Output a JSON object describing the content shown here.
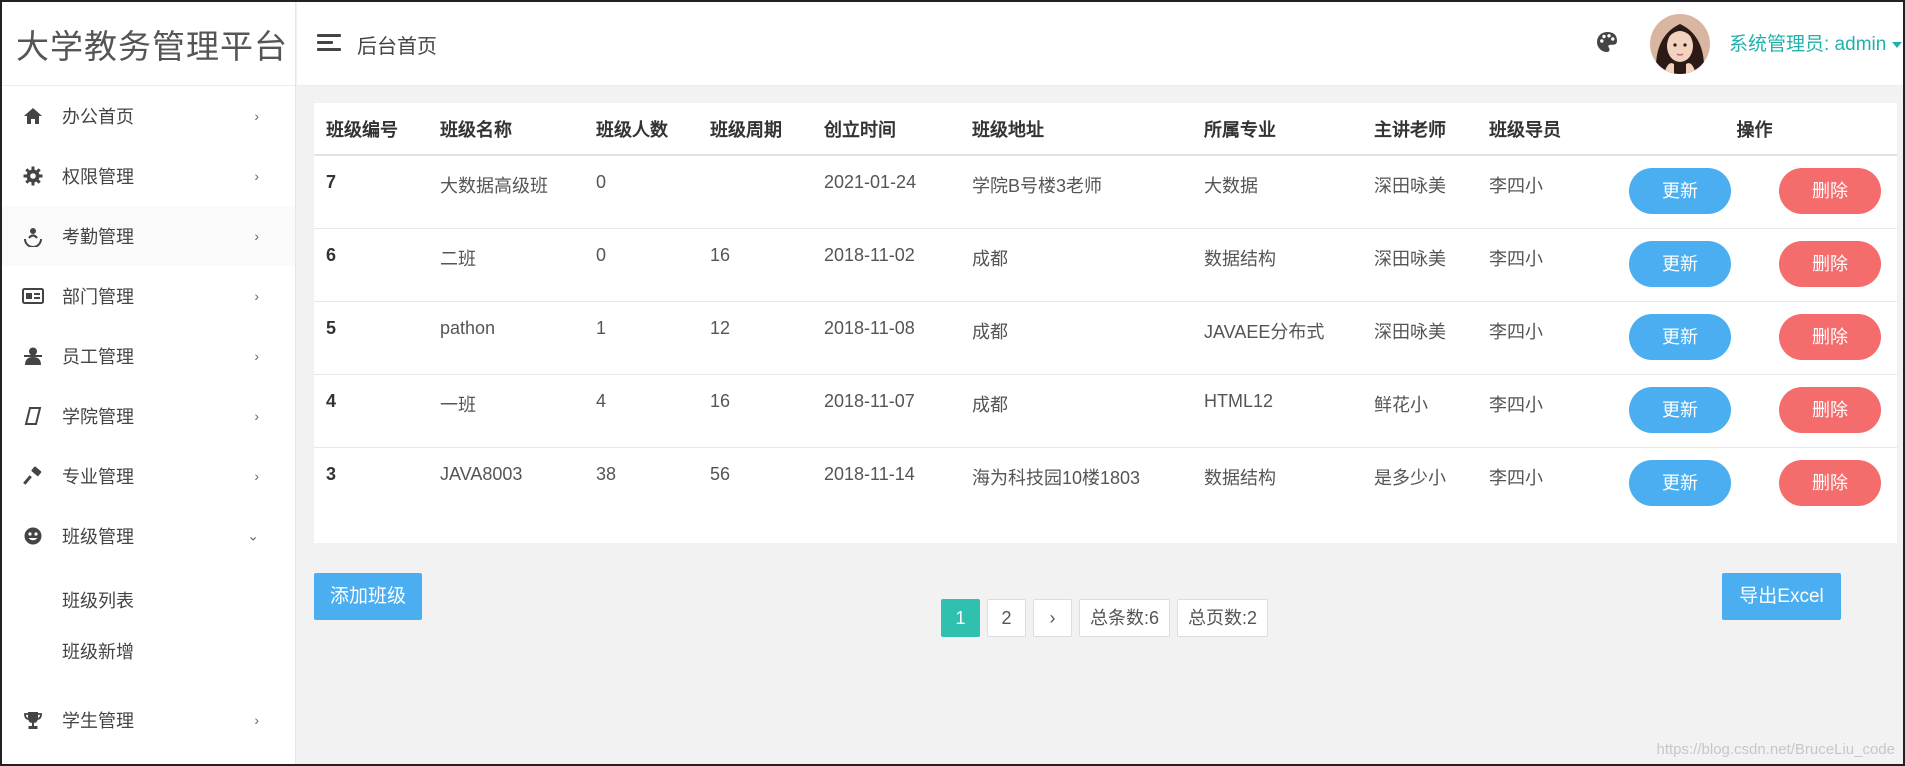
{
  "app": {
    "title": "大学教务管理平台"
  },
  "header": {
    "breadcrumb": "后台首页",
    "user_label": "系统管理员: admin"
  },
  "sidebar": {
    "items": [
      {
        "label": "办公首页",
        "icon": "home-icon",
        "chevron": "›"
      },
      {
        "label": "权限管理",
        "icon": "gear-icon",
        "chevron": "›"
      },
      {
        "label": "考勤管理",
        "icon": "attendance-icon",
        "chevron": "›"
      },
      {
        "label": "部门管理",
        "icon": "id-card-icon",
        "chevron": "›"
      },
      {
        "label": "员工管理",
        "icon": "user-icon",
        "chevron": "›"
      },
      {
        "label": "学院管理",
        "icon": "parallelogram-icon",
        "chevron": "›"
      },
      {
        "label": "专业管理",
        "icon": "hammer-icon",
        "chevron": "›"
      },
      {
        "label": "班级管理",
        "icon": "face-icon",
        "chevron": "⌄"
      },
      {
        "label": "学生管理",
        "icon": "trophy-icon",
        "chevron": "›"
      }
    ],
    "subitems": [
      {
        "label": "班级列表"
      },
      {
        "label": "班级新增"
      }
    ]
  },
  "table": {
    "headers": [
      "班级编号",
      "班级名称",
      "班级人数",
      "班级周期",
      "创立时间",
      "班级地址",
      "所属专业",
      "主讲老师",
      "班级导员",
      "操作"
    ],
    "rows": [
      {
        "id": "7",
        "name": "大数据高级班",
        "count": "0",
        "period": "",
        "created": "2021-01-24",
        "address": "学院B号楼3老师",
        "major": "大数据",
        "teacher": "深田咏美",
        "counselor": "李四小"
      },
      {
        "id": "6",
        "name": "二班",
        "count": "0",
        "period": "16",
        "created": "2018-11-02",
        "address": "成都",
        "major": "数据结构",
        "teacher": "深田咏美",
        "counselor": "李四小"
      },
      {
        "id": "5",
        "name": "pathon",
        "count": "1",
        "period": "12",
        "created": "2018-11-08",
        "address": "成都",
        "major": "JAVAEE分布式",
        "teacher": "深田咏美",
        "counselor": "李四小"
      },
      {
        "id": "4",
        "name": "一班",
        "count": "4",
        "period": "16",
        "created": "2018-11-07",
        "address": "成都",
        "major": "HTML12",
        "teacher": "鲜花小",
        "counselor": "李四小"
      },
      {
        "id": "3",
        "name": "JAVA8003",
        "count": "38",
        "period": "56",
        "created": "2018-11-14",
        "address": "海为科技园10楼1803",
        "major": "数据结构",
        "teacher": "是多少小",
        "counselor": "李四小"
      }
    ],
    "update_label": "更新",
    "delete_label": "删除"
  },
  "actions": {
    "add_label": "添加班级",
    "export_label": "导出Excel"
  },
  "pagination": {
    "pages": [
      "1",
      "2"
    ],
    "current": "1",
    "next": "›",
    "total_items": "总条数:6",
    "total_pages": "总页数:2"
  },
  "watermark": "https://blog.csdn.net/BruceLiu_code",
  "colors": {
    "primary_button": "#4aaef0",
    "danger_button": "#f46c6c",
    "accent": "#20b2aa",
    "active_page": "#2fc0b0"
  }
}
